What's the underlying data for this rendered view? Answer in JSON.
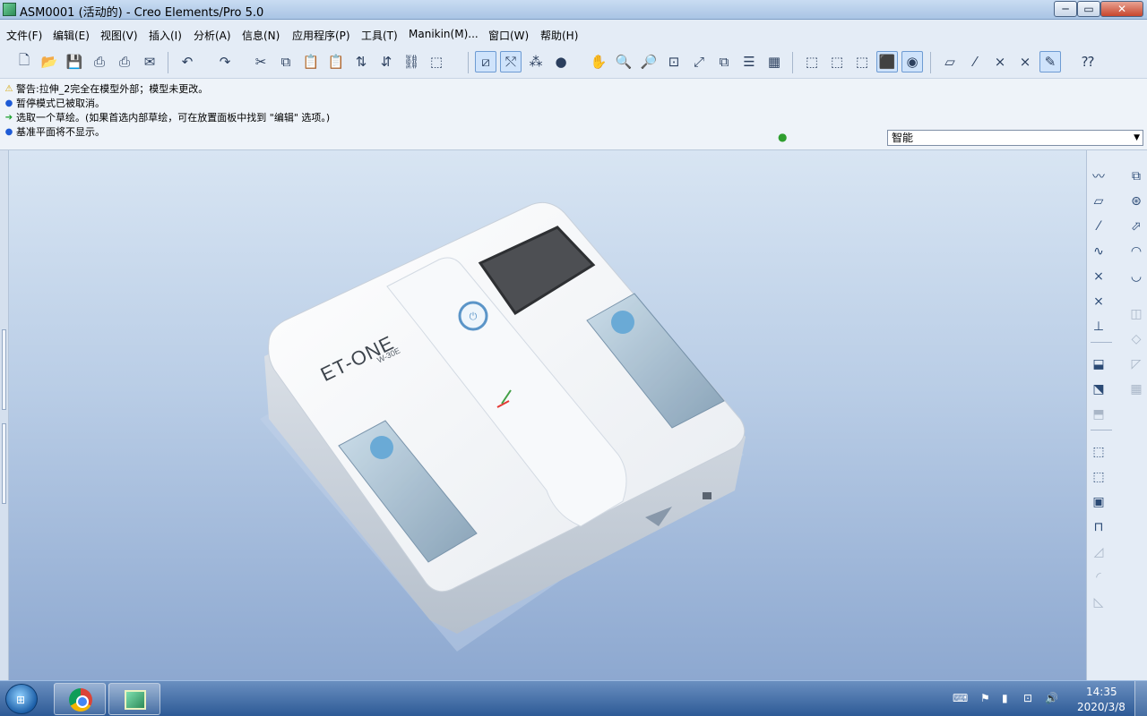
{
  "window": {
    "title": "ASM0001 (活动的) - Creo Elements/Pro 5.0",
    "min_label": "─",
    "max_label": "▭",
    "close_label": "✕"
  },
  "menu": [
    "文件(F)",
    "编辑(E)",
    "视图(V)",
    "插入(I)",
    "分析(A)",
    "信息(N)",
    "应用程序(P)",
    "工具(T)",
    "Manikin(M)...",
    "窗口(W)",
    "帮助(H)"
  ],
  "messages": [
    {
      "icon": "warning-icon",
      "glyph": "⚠",
      "text": "警告:拉伸_2完全在模型外部；模型未更改。"
    },
    {
      "icon": "info-bullet-icon",
      "glyph": "●",
      "text": "暂停模式已被取消。"
    },
    {
      "icon": "prompt-arrow-icon",
      "glyph": "➔",
      "text": "选取一个草绘。(如果首选内部草绘，可在放置面板中找到 \"编辑\" 选项。)"
    },
    {
      "icon": "info-bullet-icon",
      "glyph": "●",
      "text": "基准平面将不显示。"
    }
  ],
  "filter": {
    "selected": "智能"
  },
  "model": {
    "brand": "ET-ONE",
    "model_no": "W-30E"
  },
  "taskbar": {
    "time": "14:35",
    "date": "2020/3/8"
  },
  "colors": {
    "accent": "#4a7fc0",
    "viewport_top": "#d8e5f3",
    "viewport_bottom": "#8da8d0",
    "device_body": "#f4f6f8",
    "button_blue": "#6aaad6"
  }
}
